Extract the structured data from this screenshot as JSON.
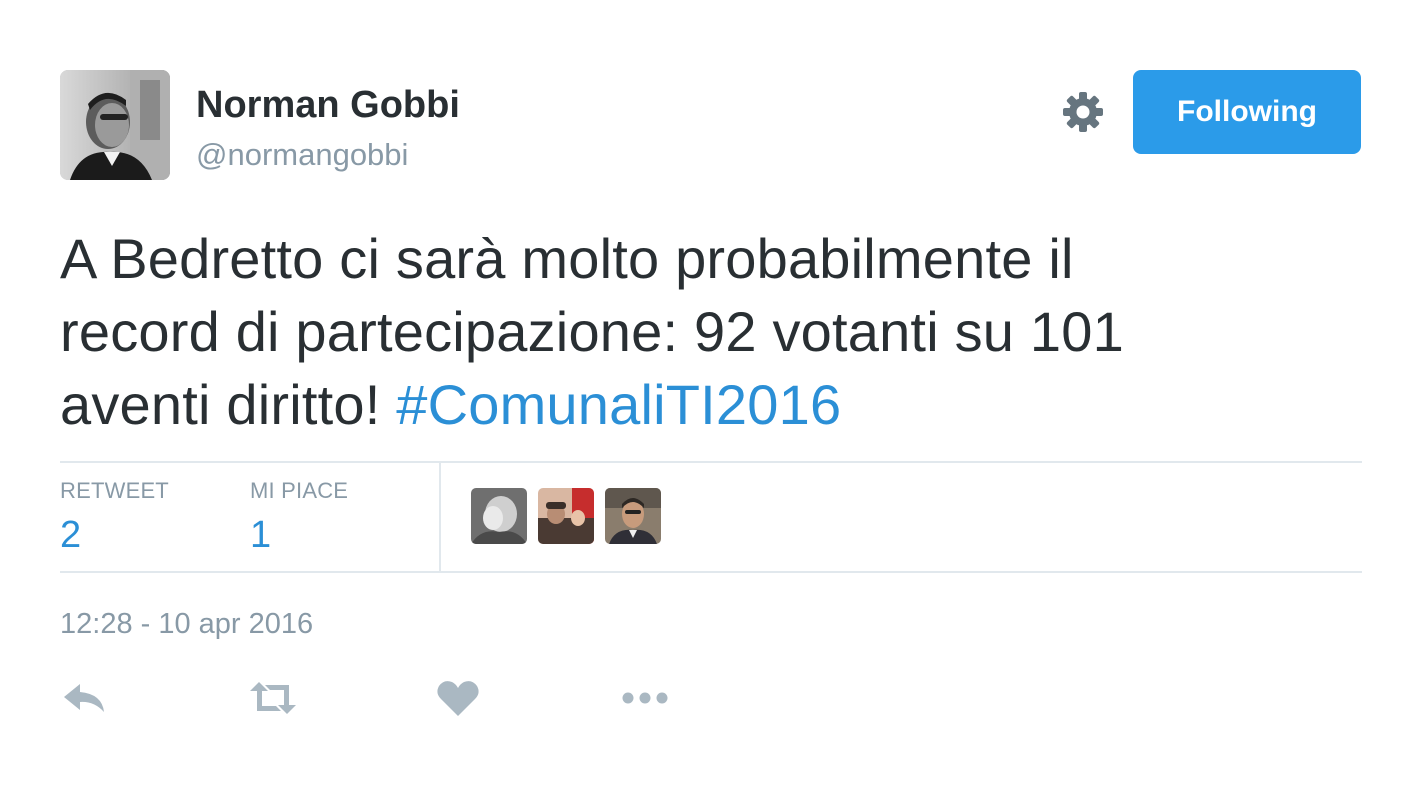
{
  "user": {
    "display_name": "Norman Gobbi",
    "screen_name": "@normangobbi",
    "avatar_icon": "profile-photo"
  },
  "header": {
    "settings_icon": "gear-icon",
    "follow_button_label": "Following"
  },
  "tweet": {
    "text_lines": [
      "A Bedretto ci sarà molto probabilmente il",
      "record di partecipazione: 92 votanti su 101",
      "aventi diritto! "
    ],
    "hashtag": "#ComunaliTI2016"
  },
  "stats": {
    "retweets_label": "RETWEET",
    "retweets_count": "2",
    "likes_label": "MI PIACE",
    "likes_count": "1",
    "liker_avatars": [
      "liker-avatar-1",
      "liker-avatar-2",
      "liker-avatar-3"
    ]
  },
  "timestamp": "12:28 - 10 apr 2016",
  "actions": [
    "reply-icon",
    "retweet-icon",
    "heart-icon",
    "more-icon"
  ],
  "colors": {
    "accent": "#2b9be9",
    "link": "#2b8fd6",
    "muted": "#8899a6",
    "text": "#292f33",
    "divider": "#e1e8ed"
  }
}
